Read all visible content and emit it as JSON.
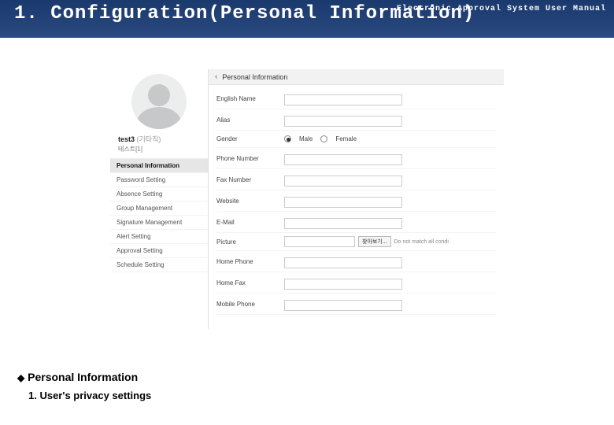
{
  "header": {
    "title": "1. Configuration(Personal Information)",
    "right": "Electronic Approval System User Manual"
  },
  "user": {
    "name": "test3",
    "role": "(기타직)",
    "sub": "테스트[1]"
  },
  "nav": {
    "items": [
      {
        "label": "Personal Information",
        "active": true
      },
      {
        "label": "Password Setting",
        "active": false
      },
      {
        "label": "Absence Setting",
        "active": false
      },
      {
        "label": "Group Management",
        "active": false
      },
      {
        "label": "Signature Management",
        "active": false
      },
      {
        "label": "Alert Setting",
        "active": false
      },
      {
        "label": "Approval Setting",
        "active": false
      },
      {
        "label": "Schedule Setting",
        "active": false
      }
    ]
  },
  "panel": {
    "back": "‹",
    "title": "Personal Information"
  },
  "form": {
    "english_name": {
      "label": "English Name",
      "value": ""
    },
    "alias": {
      "label": "Alias",
      "value": ""
    },
    "gender": {
      "label": "Gender",
      "male": "Male",
      "female": "Female",
      "selected": "male"
    },
    "phone": {
      "label": "Phone Number",
      "value": ""
    },
    "fax": {
      "label": "Fax Number",
      "value": ""
    },
    "website": {
      "label": "Website",
      "value": ""
    },
    "email": {
      "label": "E-Mail",
      "value": ""
    },
    "picture": {
      "label": "Picture",
      "button": "찾아보기...",
      "hint": "Do not match all condi"
    },
    "home_phone": {
      "label": "Home Phone",
      "value": ""
    },
    "home_fax": {
      "label": "Home Fax",
      "value": ""
    },
    "mobile": {
      "label": "Mobile Phone",
      "value": ""
    }
  },
  "footer": {
    "line1": "Personal Information",
    "line2": "1. User's privacy settings"
  }
}
